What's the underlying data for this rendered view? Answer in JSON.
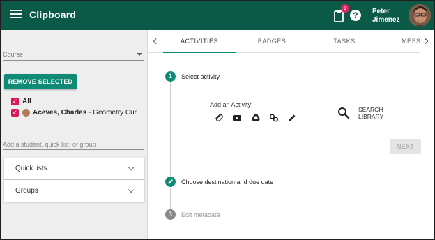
{
  "app": {
    "title": "Clipboard",
    "notification_count": "1"
  },
  "user": {
    "name_line1": "Peter",
    "name_line2": "Jimenez"
  },
  "sidebar": {
    "course_placeholder": "Course",
    "remove_button": "REMOVE SELECTED",
    "all_label": "All",
    "student": {
      "name": "Aceves, Charles",
      "detail": " - Geometry Cur"
    },
    "add_placeholder": "Add a student, quick list, or group",
    "panels": [
      "Quick lists",
      "Groups"
    ]
  },
  "tabs": [
    "ACTIVITIES",
    "BADGES",
    "TASKS",
    "MESSA"
  ],
  "steps": [
    {
      "number": "1",
      "title": "Select activity",
      "state": "active"
    },
    {
      "number": "",
      "title": "Choose destination and due date",
      "state": "edit"
    },
    {
      "number": "3",
      "title": "Edit metadata",
      "state": "inactive"
    }
  ],
  "activity": {
    "add_label": "Add an Activity:",
    "icons": [
      "paperclip-icon",
      "youtube-icon",
      "google-drive-icon",
      "link-icon",
      "pencil-icon"
    ],
    "search_line1": "SEARCH",
    "search_line2": "LIBRARY",
    "next_label": "NEXT"
  },
  "colors": {
    "header": "#0b5a47",
    "accent": "#0f8a75",
    "checkbox": "#d8185c",
    "badge": "#e0245e"
  }
}
